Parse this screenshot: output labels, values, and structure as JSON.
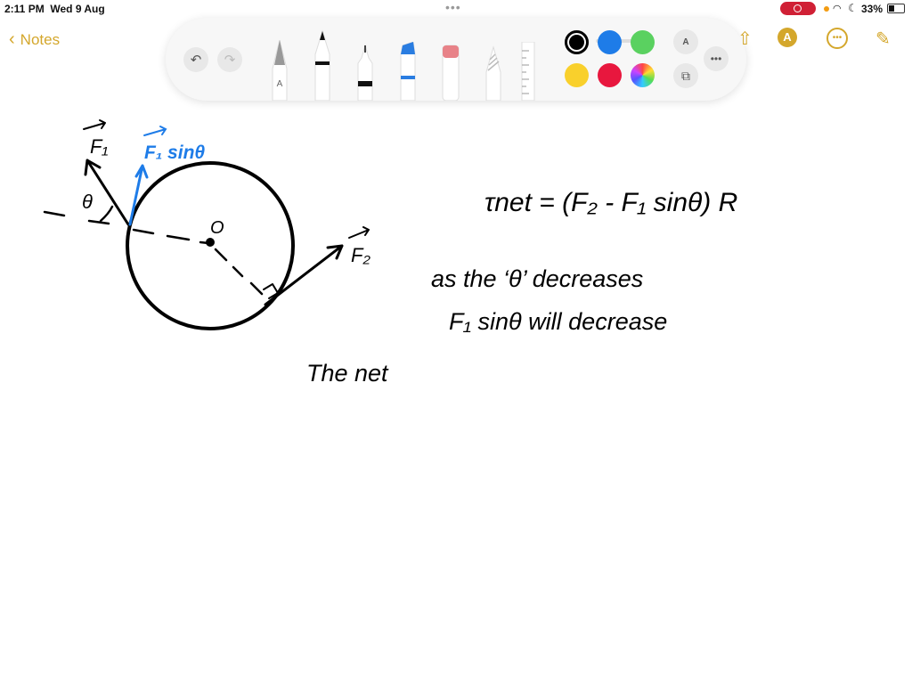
{
  "status_bar": {
    "time": "2:11 PM",
    "date": "Wed 9 Aug",
    "multitask_dots": "•••",
    "battery_percent": "33%",
    "icons": [
      "screen-record-icon",
      "orange-dot-icon",
      "wifi-icon",
      "moon-icon",
      "battery-icon"
    ]
  },
  "nav": {
    "back_label": "Notes"
  },
  "toolbar": {
    "undo_icon": "↶",
    "redo_icon": "↷",
    "tools": [
      "pen",
      "marker",
      "fineliner",
      "highlighter",
      "eraser",
      "pencil",
      "ruler"
    ],
    "pen_label": "A",
    "colors": [
      {
        "name": "black",
        "hex": "#000000",
        "selected": true
      },
      {
        "name": "blue",
        "hex": "#1e7ce8"
      },
      {
        "name": "green",
        "hex": "#5ad160"
      },
      {
        "name": "yellow",
        "hex": "#f9d02c"
      },
      {
        "name": "red",
        "hex": "#e8173e"
      },
      {
        "name": "color-picker",
        "hex": "multicolor"
      }
    ],
    "text_icon": "A",
    "more_icon": "•••"
  },
  "top_actions": {
    "share_icon": "⇧",
    "markup_icon": "A",
    "more_icon": "•••",
    "compose_icon": "✎"
  },
  "note": {
    "labels": {
      "f1": "F₁",
      "f1_sin": "F₁ sinθ",
      "theta": "θ",
      "origin": "O",
      "f2": "F₂"
    },
    "equation": "τnet = (F₂ - F₁ sinθ) R",
    "line1": "as the ‘θ’ decreases",
    "line2": "F₁ sinθ will decrease",
    "line3": "The net"
  }
}
